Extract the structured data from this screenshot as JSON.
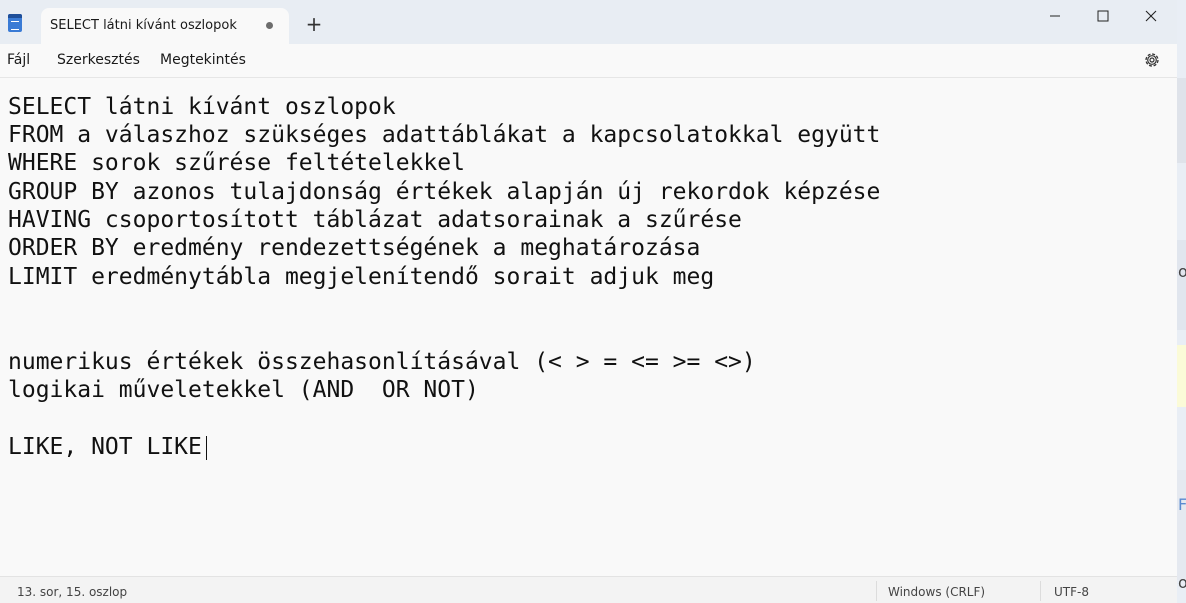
{
  "window": {
    "tab_title": "SELECT látni kívánt oszlopok",
    "new_tab_label": "+"
  },
  "menu": {
    "file": "Fájl",
    "edit": "Szerkesztés",
    "view": "Megtekintés"
  },
  "editor": {
    "lines": [
      "SELECT látni kívánt oszlopok",
      "FROM a válaszhoz szükséges adattáblákat a kapcsolatokkal együtt",
      "WHERE sorok szűrése feltételekkel",
      "GROUP BY azonos tulajdonság értékek alapján új rekordok képzése",
      "HAVING csoportosított táblázat adatsorainak a szűrése",
      "ORDER BY eredmény rendezettségének a meghatározása",
      "LIMIT eredménytábla megjelenítendő sorait adjuk meg",
      "",
      "",
      "numerikus értékek összehasonlításával (< > = <= >= <>)",
      "logikai műveletekkel (AND  OR NOT)",
      "",
      "LIKE, NOT LIKE"
    ]
  },
  "status": {
    "position": "13. sor, 15. oszlop",
    "line_ending": "Windows (CRLF)",
    "encoding": "UTF-8"
  },
  "background_window": {
    "fragments": [
      "or",
      "Fr",
      "o"
    ]
  },
  "icons": {
    "app": "notepad-icon",
    "settings": "gear-icon",
    "unsaved": "unsaved-dot-icon"
  }
}
